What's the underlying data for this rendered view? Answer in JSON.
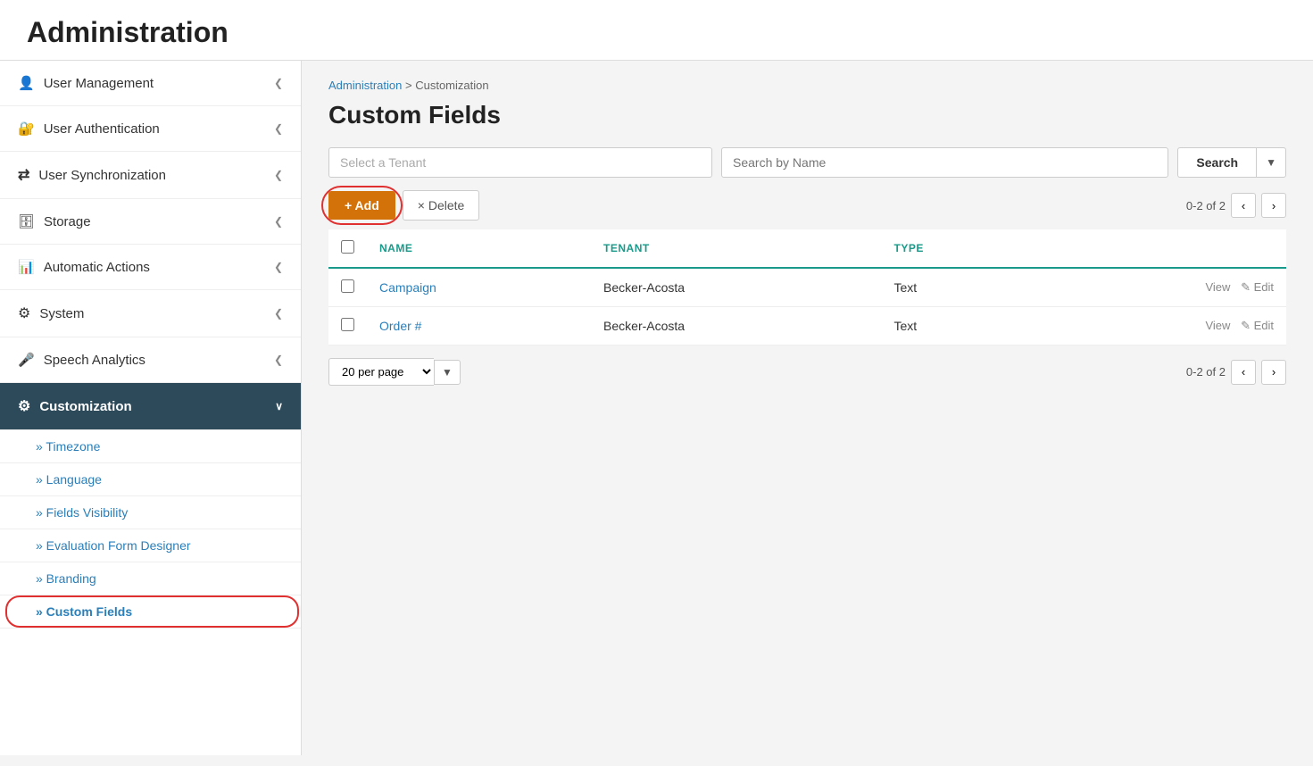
{
  "header": {
    "title": "Administration"
  },
  "sidebar": {
    "items": [
      {
        "id": "user-management",
        "label": "User Management",
        "icon": "user",
        "active": false
      },
      {
        "id": "user-authentication",
        "label": "User Authentication",
        "icon": "auth",
        "active": false
      },
      {
        "id": "user-synchronization",
        "label": "User Synchronization",
        "icon": "sync",
        "active": false
      },
      {
        "id": "storage",
        "label": "Storage",
        "icon": "storage",
        "active": false
      },
      {
        "id": "automatic-actions",
        "label": "Automatic Actions",
        "icon": "auto",
        "active": false
      },
      {
        "id": "system",
        "label": "System",
        "icon": "system",
        "active": false
      },
      {
        "id": "speech-analytics",
        "label": "Speech Analytics",
        "icon": "speech",
        "active": false
      },
      {
        "id": "customization",
        "label": "Customization",
        "icon": "custom",
        "active": true
      }
    ],
    "subitems": [
      {
        "id": "timezone",
        "label": "» Timezone",
        "active": false,
        "highlighted": false
      },
      {
        "id": "language",
        "label": "» Language",
        "active": false,
        "highlighted": false
      },
      {
        "id": "fields-visibility",
        "label": "» Fields Visibility",
        "active": false,
        "highlighted": false
      },
      {
        "id": "evaluation-form",
        "label": "» Evaluation Form Designer",
        "active": false,
        "highlighted": false
      },
      {
        "id": "branding",
        "label": "» Branding",
        "active": false,
        "highlighted": false
      },
      {
        "id": "custom-fields",
        "label": "» Custom Fields",
        "active": true,
        "highlighted": true
      }
    ]
  },
  "breadcrumb": {
    "parent": "Administration",
    "separator": ">",
    "current": "Customization"
  },
  "main": {
    "title": "Custom Fields",
    "tenant_placeholder": "Select a Tenant",
    "search_placeholder": "Search by Name",
    "search_label": "Search",
    "add_label": "+ Add",
    "delete_label": "× Delete",
    "pagination": {
      "info": "0-2 of 2",
      "per_page": "20 per page"
    },
    "table": {
      "columns": [
        "",
        "NAME",
        "TENANT",
        "TYPE",
        ""
      ],
      "rows": [
        {
          "id": 1,
          "name": "Campaign",
          "tenant": "Becker-Acosta",
          "type": "Text"
        },
        {
          "id": 2,
          "name": "Order #",
          "tenant": "Becker-Acosta",
          "type": "Text"
        }
      ]
    },
    "row_actions": {
      "view": "View",
      "edit": "Edit"
    }
  }
}
